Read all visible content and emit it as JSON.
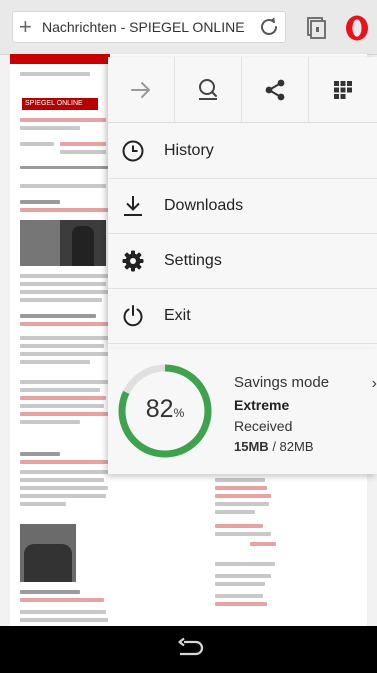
{
  "addressbar": {
    "url_text": "Nachrichten - SPIEGEL ONLINE"
  },
  "page": {
    "logo_text": "SPIEGEL ONLINE"
  },
  "menu": {
    "actions": [
      {
        "icon": "arrow-forward-icon"
      },
      {
        "icon": "search-page-icon"
      },
      {
        "icon": "share-icon"
      },
      {
        "icon": "apps-grid-icon"
      }
    ],
    "items": [
      {
        "label": "History",
        "icon": "history-icon"
      },
      {
        "label": "Downloads",
        "icon": "download-icon"
      },
      {
        "label": "Settings",
        "icon": "gear-icon"
      },
      {
        "label": "Exit",
        "icon": "power-icon"
      }
    ]
  },
  "savings": {
    "percent_value": 82,
    "percent_number": "82",
    "percent_sign": "%",
    "title": "Savings mode",
    "mode": "Extreme",
    "received_label": "Received",
    "received_amount": "15MB",
    "total_amount": "/ 82MB",
    "ring_color": "#3fa34d"
  },
  "colors": {
    "opera_red": "#e8121b",
    "spiegel_red": "#c90000"
  }
}
